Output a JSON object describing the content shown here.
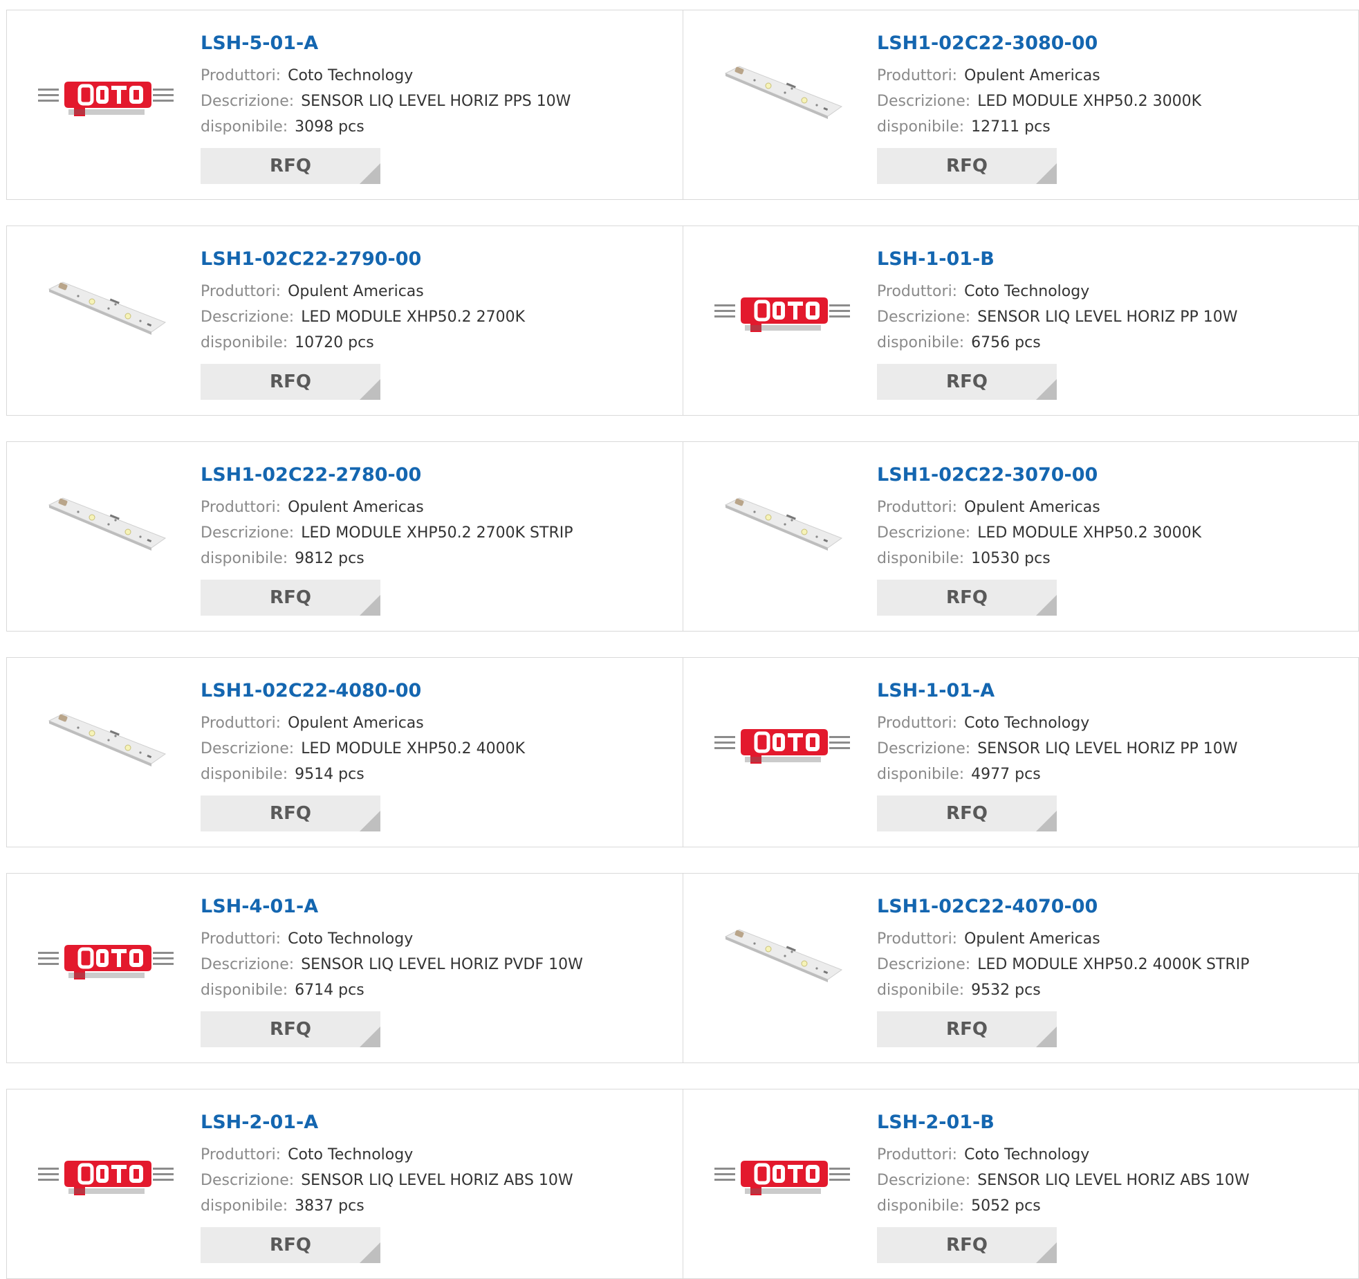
{
  "labels": {
    "manufacturer": "Produttori:",
    "description": "Descrizione:",
    "available": "disponibile:",
    "rfq": "RFQ"
  },
  "colors": {
    "link": "#1466b0",
    "label": "#8a8a8a",
    "value": "#333333",
    "button_bg": "#ebebeb",
    "coto_red": "#e3192d"
  },
  "products": [
    {
      "part": "LSH-5-01-A",
      "manufacturer": "Coto Technology",
      "description": "SENSOR LIQ LEVEL HORIZ PPS 10W",
      "stock": "3098 pcs",
      "image": "coto-technology-logo"
    },
    {
      "part": "LSH1-02C22-3080-00",
      "manufacturer": "Opulent Americas",
      "description": "LED MODULE XHP50.2 3000K",
      "stock": "12711 pcs",
      "image": "led-module-photo"
    },
    {
      "part": "LSH1-02C22-2790-00",
      "manufacturer": "Opulent Americas",
      "description": "LED MODULE XHP50.2 2700K",
      "stock": "10720 pcs",
      "image": "led-module-photo"
    },
    {
      "part": "LSH-1-01-B",
      "manufacturer": "Coto Technology",
      "description": "SENSOR LIQ LEVEL HORIZ PP 10W",
      "stock": "6756 pcs",
      "image": "coto-technology-logo"
    },
    {
      "part": "LSH1-02C22-2780-00",
      "manufacturer": "Opulent Americas",
      "description": "LED MODULE XHP50.2 2700K STRIP",
      "stock": "9812 pcs",
      "image": "led-module-photo"
    },
    {
      "part": "LSH1-02C22-3070-00",
      "manufacturer": "Opulent Americas",
      "description": "LED MODULE XHP50.2 3000K",
      "stock": "10530 pcs",
      "image": "led-module-photo"
    },
    {
      "part": "LSH1-02C22-4080-00",
      "manufacturer": "Opulent Americas",
      "description": "LED MODULE XHP50.2 4000K",
      "stock": "9514 pcs",
      "image": "led-module-photo"
    },
    {
      "part": "LSH-1-01-A",
      "manufacturer": "Coto Technology",
      "description": "SENSOR LIQ LEVEL HORIZ PP 10W",
      "stock": "4977 pcs",
      "image": "coto-technology-logo"
    },
    {
      "part": "LSH-4-01-A",
      "manufacturer": "Coto Technology",
      "description": "SENSOR LIQ LEVEL HORIZ PVDF 10W",
      "stock": "6714 pcs",
      "image": "coto-technology-logo"
    },
    {
      "part": "LSH1-02C22-4070-00",
      "manufacturer": "Opulent Americas",
      "description": "LED MODULE XHP50.2 4000K STRIP",
      "stock": "9532 pcs",
      "image": "led-module-photo"
    },
    {
      "part": "LSH-2-01-A",
      "manufacturer": "Coto Technology",
      "description": "SENSOR LIQ LEVEL HORIZ ABS 10W",
      "stock": "3837 pcs",
      "image": "coto-technology-logo"
    },
    {
      "part": "LSH-2-01-B",
      "manufacturer": "Coto Technology",
      "description": "SENSOR LIQ LEVEL HORIZ ABS 10W",
      "stock": "5052 pcs",
      "image": "coto-technology-logo"
    }
  ]
}
